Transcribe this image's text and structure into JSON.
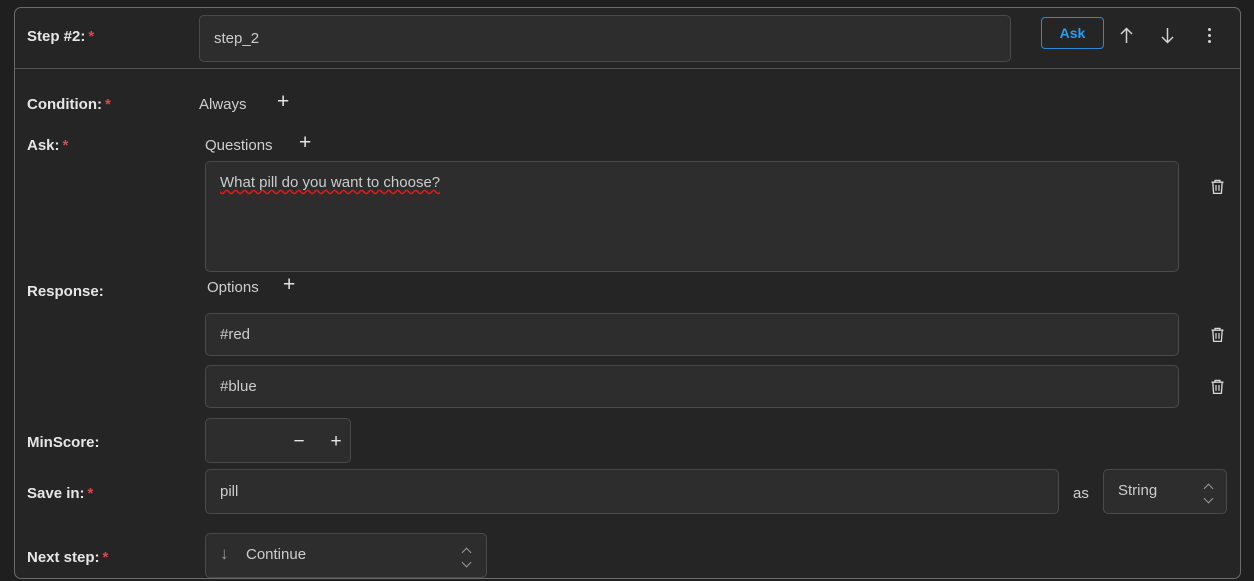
{
  "header": {
    "label": "Step #2:",
    "required_marker": "*",
    "step_name_value": "step_2",
    "step_name_placeholder": "",
    "ask_button_label": "Ask",
    "move_up_icon": "arrow-up-icon",
    "move_down_icon": "arrow-down-icon",
    "more_icon": "vertical-dots-icon"
  },
  "rows": {
    "condition": {
      "label": "Condition:",
      "required_marker": "*",
      "value": "Always",
      "add_label": "+"
    },
    "ask": {
      "label": "Ask:",
      "required_marker": "*",
      "questions_heading": "Questions",
      "add_label": "+",
      "question_text": "What pill do you want to choose?",
      "question_placeholder": "",
      "delete_icon": "trash-icon"
    },
    "response": {
      "label": "Response:",
      "options_heading": "Options",
      "add_label": "+",
      "options": [
        {
          "value": "#red",
          "delete_icon": "trash-icon"
        },
        {
          "value": "#blue",
          "delete_icon": "trash-icon"
        }
      ]
    },
    "minScore": {
      "label": "MinScore:",
      "value": "",
      "placeholder": "",
      "decrement_label": "−",
      "increment_label": "+"
    },
    "saveIn": {
      "label": "Save in:",
      "required_marker": "*",
      "value": "pill",
      "placeholder": "",
      "as_label": "as",
      "type_value": "String"
    },
    "nextStep": {
      "label": "Next step:",
      "required_marker": "*",
      "value": "Continue",
      "arrow_icon": "arrow-down-icon"
    }
  },
  "colors": {
    "accent": "#2b9cf0",
    "required": "#d64c4c",
    "panel": "#252526",
    "field": "#2d2d2d",
    "spellcheck": "#e01b1b"
  }
}
